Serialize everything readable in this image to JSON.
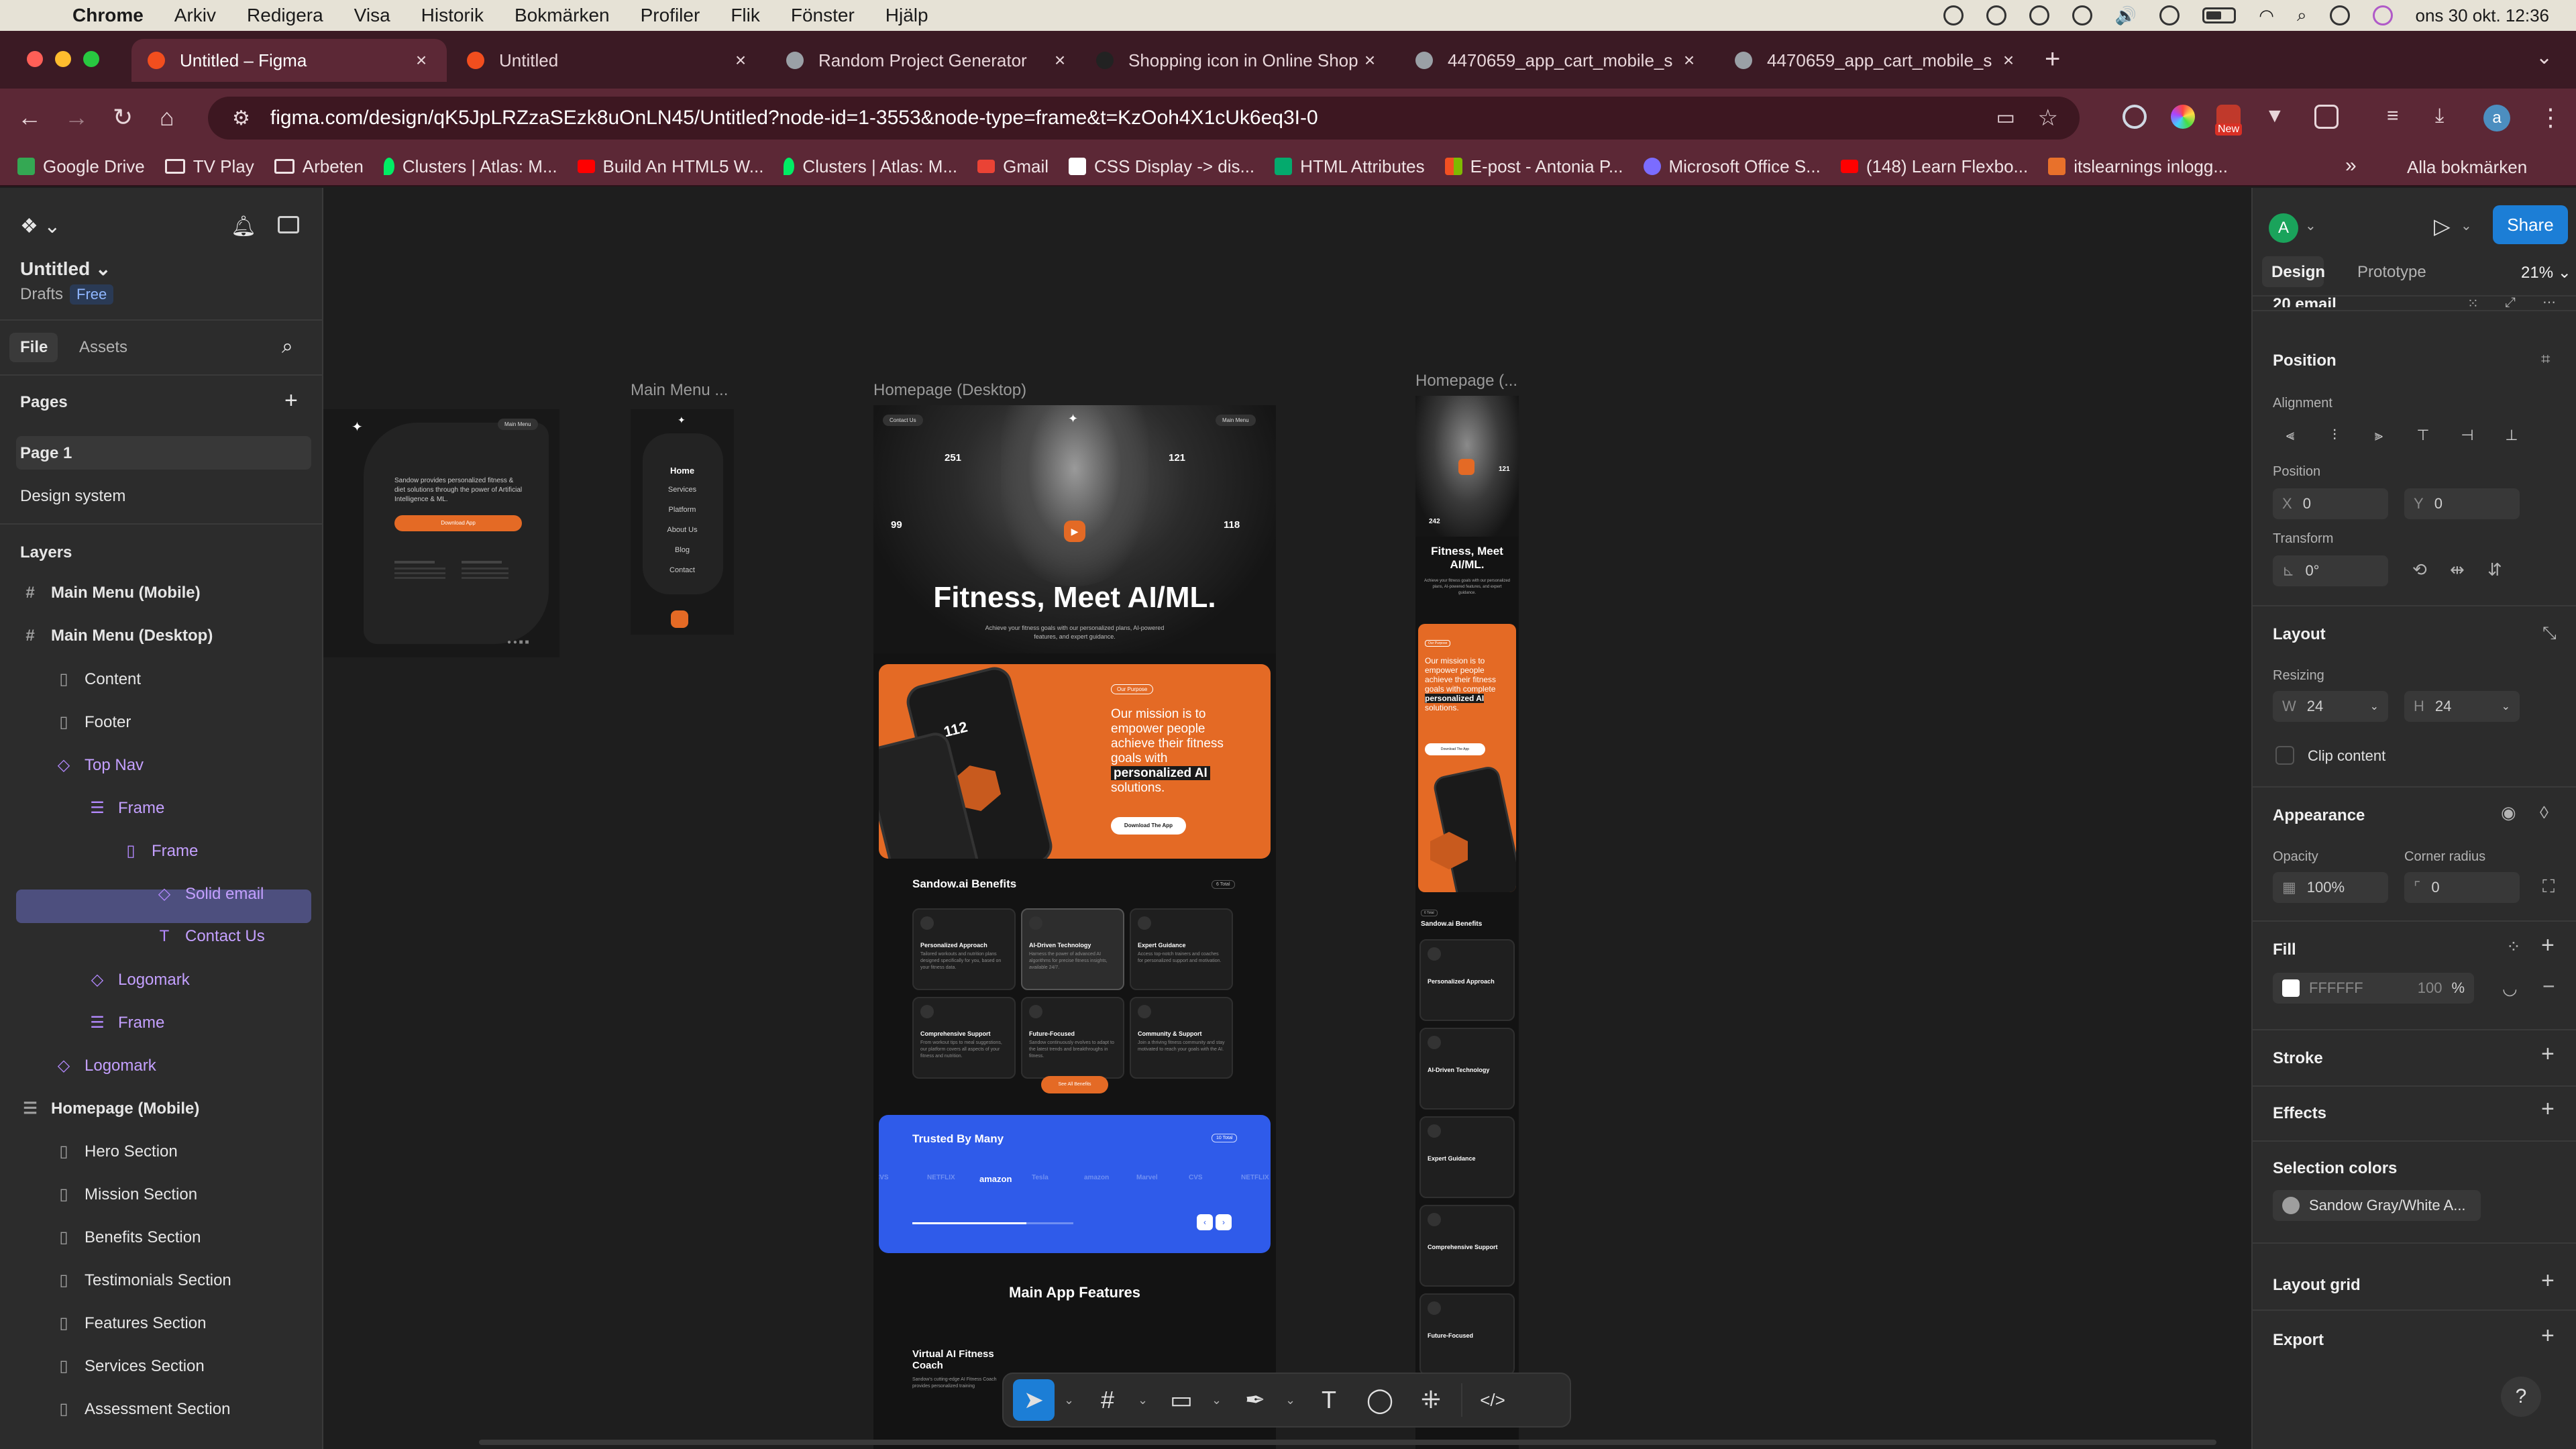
{
  "menubar": {
    "app": "Chrome",
    "items": [
      "Arkiv",
      "Redigera",
      "Visa",
      "Historik",
      "Bokmärken",
      "Profiler",
      "Flik",
      "Fönster",
      "Hjälp"
    ],
    "clock": "ons 30 okt.  12:36"
  },
  "tabs": [
    {
      "title": "Untitled – Figma",
      "active": true,
      "favicon_color": "#f24e1e"
    },
    {
      "title": "Untitled",
      "active": false,
      "favicon_color": "#f24e1e"
    },
    {
      "title": "Random Project Generator",
      "active": false,
      "favicon_color": "#9aa0a6"
    },
    {
      "title": "Shopping icon in Online Shop",
      "active": false,
      "favicon_color": "#222222"
    },
    {
      "title": "4470659_app_cart_mobile_s",
      "active": false,
      "favicon_color": "#9aa0a6"
    },
    {
      "title": "4470659_app_cart_mobile_s",
      "active": false,
      "favicon_color": "#9aa0a6"
    }
  ],
  "address": {
    "url": "figma.com/design/qK5JpLRZzaSEzk8uOnLN45/Untitled?node-id=1-3553&node-type=frame&t=KzOoh4X1cUk6eq3I-0",
    "ext_badge": "New"
  },
  "bookmarks": [
    {
      "label": "Google Drive",
      "icon": "drive-icon",
      "color": "#34a853"
    },
    {
      "label": "TV Play",
      "icon": "folder-icon",
      "color": ""
    },
    {
      "label": "Arbeten",
      "icon": "folder-icon",
      "color": ""
    },
    {
      "label": "Clusters | Atlas: M...",
      "icon": "mongodb-icon",
      "color": "#00ed64"
    },
    {
      "label": "Build An HTML5 W...",
      "icon": "youtube-icon",
      "color": "#ff0000"
    },
    {
      "label": "Clusters | Atlas: M...",
      "icon": "mongodb-icon",
      "color": "#00ed64"
    },
    {
      "label": "Gmail",
      "icon": "gmail-icon",
      "color": "#ea4335"
    },
    {
      "label": "CSS Display -> dis...",
      "icon": "w3-icon",
      "color": "#ffffff"
    },
    {
      "label": "HTML Attributes",
      "icon": "w3schools-icon",
      "color": "#04aa6d"
    },
    {
      "label": "E-post - Antonia P...",
      "icon": "office-icon",
      "color": "#f25022"
    },
    {
      "label": "Microsoft Office S...",
      "icon": "edge-icon",
      "color": "#7b6cff"
    },
    {
      "label": "(148) Learn Flexbo...",
      "icon": "youtube-icon",
      "color": "#ff0000"
    },
    {
      "label": "itslearnings inlogg...",
      "icon": "its-icon",
      "color": "#e8712b"
    }
  ],
  "bookmarks_all": "Alla bokmärken",
  "figma": {
    "file_name": "Untitled",
    "file_location": "Drafts",
    "plan_badge": "Free",
    "tabs": {
      "file": "File",
      "assets": "Assets"
    },
    "pages_heading": "Pages",
    "pages": [
      "Page 1",
      "Design system"
    ],
    "layers_heading": "Layers",
    "layers": [
      {
        "name": "Main Menu (Mobile)",
        "icon": "#",
        "indent": 0,
        "bold": true,
        "purple": false
      },
      {
        "name": "Main Menu (Desktop)",
        "icon": "#",
        "indent": 0,
        "bold": true,
        "purple": false
      },
      {
        "name": "Content",
        "icon": "▯",
        "indent": 1,
        "bold": false,
        "purple": false
      },
      {
        "name": "Footer",
        "icon": "▯",
        "indent": 1,
        "bold": false,
        "purple": false
      },
      {
        "name": "Top Nav",
        "icon": "◇",
        "indent": 1,
        "bold": false,
        "purple": true
      },
      {
        "name": "Frame",
        "icon": "☰",
        "indent": 2,
        "bold": false,
        "purple": true
      },
      {
        "name": "Frame",
        "icon": "▯",
        "indent": 3,
        "bold": false,
        "purple": true
      },
      {
        "name": "Solid email",
        "icon": "◇",
        "indent": 4,
        "bold": false,
        "purple": true
      },
      {
        "name": "Contact Us",
        "icon": "T",
        "indent": 4,
        "bold": false,
        "purple": true
      },
      {
        "name": "Logomark",
        "icon": "◇",
        "indent": 2,
        "bold": false,
        "purple": true
      },
      {
        "name": "Frame",
        "icon": "☰",
        "indent": 2,
        "bold": false,
        "purple": true
      },
      {
        "name": "Logomark",
        "icon": "◇",
        "indent": 1,
        "bold": false,
        "purple": true
      },
      {
        "name": "Homepage (Mobile)",
        "icon": "☰",
        "indent": 0,
        "bold": true,
        "purple": false
      },
      {
        "name": "Hero Section",
        "icon": "▯",
        "indent": 1,
        "bold": false,
        "purple": false
      },
      {
        "name": "Mission Section",
        "icon": "▯",
        "indent": 1,
        "bold": false,
        "purple": false
      },
      {
        "name": "Benefits Section",
        "icon": "▯",
        "indent": 1,
        "bold": false,
        "purple": false
      },
      {
        "name": "Testimonials Section",
        "icon": "▯",
        "indent": 1,
        "bold": false,
        "purple": false
      },
      {
        "name": "Features Section",
        "icon": "▯",
        "indent": 1,
        "bold": false,
        "purple": false
      },
      {
        "name": "Services Section",
        "icon": "▯",
        "indent": 1,
        "bold": false,
        "purple": false
      },
      {
        "name": "Assessment Section",
        "icon": "▯",
        "indent": 1,
        "bold": false,
        "purple": false
      }
    ],
    "right": {
      "user_initial": "A",
      "share": "Share",
      "tab_design": "Design",
      "tab_prototype": "Prototype",
      "zoom": "21%",
      "selected_name": "20 email",
      "position_title": "Position",
      "alignment_label": "Alignment",
      "position_label": "Position",
      "x_label": "X",
      "x_value": "0",
      "y_label": "Y",
      "y_value": "0",
      "transform_label": "Transform",
      "rotation_value": "0°",
      "layout_title": "Layout",
      "resizing_label": "Resizing",
      "w_label": "W",
      "w_value": "24",
      "h_label": "H",
      "h_value": "24",
      "clip_content": "Clip content",
      "appearance_title": "Appearance",
      "opacity_label": "Opacity",
      "opacity_value": "100%",
      "radius_label": "Corner radius",
      "radius_value": "0",
      "fill_title": "Fill",
      "fill_hex": "FFFFFF",
      "fill_opacity": "100",
      "fill_pct": "%",
      "stroke_title": "Stroke",
      "effects_title": "Effects",
      "selection_colors_title": "Selection colors",
      "selection_color_name": "Sandow Gray/White A...",
      "layout_grid_title": "Layout grid",
      "export_title": "Export"
    },
    "canvas": {
      "labels": {
        "menu_mobile": "Main Menu ...",
        "home_desktop": "Homepage (Desktop)",
        "home_mobile": "Homepage (..."
      },
      "menu_desktop": {
        "text": "Sandow provides personalized fitness & diet solutions through the power of Artificial Intelligence & ML.",
        "button": "Download App",
        "menu_pill": "Main Menu"
      },
      "menu_mobile_items": [
        "Home",
        "Services",
        "Platform",
        "About Us",
        "Blog",
        "Contact"
      ],
      "desktop": {
        "contact_pill": "Contact Us",
        "menu_pill": "Main Menu",
        "stats": [
          "251",
          "121",
          "99",
          "118"
        ],
        "hero_title": "Fitness, Meet AI/ML.",
        "hero_sub": "Achieve your fitness goals with our personalized plans, AI-powered features, and expert guidance.",
        "mission_tag": "Our Purpose",
        "mission_text": "Our mission is to empower people achieve their fitness goals with",
        "mission_highlight": "personalized AI",
        "mission_end": "solutions.",
        "mission_button": "Download The App",
        "phone_bpm": "112",
        "benefits_title": "Sandow.ai Benefits",
        "benefits_tag": "6 Total",
        "benefits": [
          {
            "title": "Personalized Approach",
            "desc": "Tailored workouts and nutrition plans designed specifically for you, based on your fitness data."
          },
          {
            "title": "AI-Driven Technology",
            "desc": "Harness the power of advanced AI algorithms for precise fitness insights, available 24/7."
          },
          {
            "title": "Expert Guidance",
            "desc": "Access top-notch trainers and coaches for personalized support and motivation."
          },
          {
            "title": "Comprehensive Support",
            "desc": "From workout tips to meal suggestions, our platform covers all aspects of your fitness and nutrition."
          },
          {
            "title": "Future-Focused",
            "desc": "Sandow continuously evolves to adapt to the latest trends and breakthroughs in fitness."
          },
          {
            "title": "Community & Support",
            "desc": "Join a thriving fitness community and stay motivated to reach your goals with the AI."
          }
        ],
        "benefits_button": "See All Benefits",
        "trusted_title": "Trusted By Many",
        "trusted_tag": "10 Total",
        "logos": [
          "CVS",
          "NETFLIX",
          "amazon",
          "Tesla",
          "amazon",
          "Marvel",
          "CVS",
          "NETFLIX"
        ],
        "features_title": "Main App Features",
        "feature_first": "Virtual AI Fitness Coach",
        "feature_first_desc": "Sandow's cutting-edge AI Fitness Coach provides personalized training"
      },
      "mobile": {
        "stats": [
          "242",
          "121"
        ],
        "hero_title": "Fitness, Meet AI/ML.",
        "hero_sub": "Achieve your fitness goals with our personalized plans, AI-powered features, and expert guidance.",
        "mission_tag": "Our Purpose",
        "mission_text": "Our mission is to empower people achieve their fitness goals with complete",
        "mission_highlight": "personalized AI",
        "mission_end": "solutions.",
        "mission_button": "Download The App",
        "benefits_tag": "6 Total",
        "benefits_title": "Sandow.ai Benefits",
        "benefits": [
          "Personalized Approach",
          "AI-Driven Technology",
          "Expert Guidance",
          "Comprehensive Support",
          "Future-Focused"
        ]
      }
    }
  }
}
